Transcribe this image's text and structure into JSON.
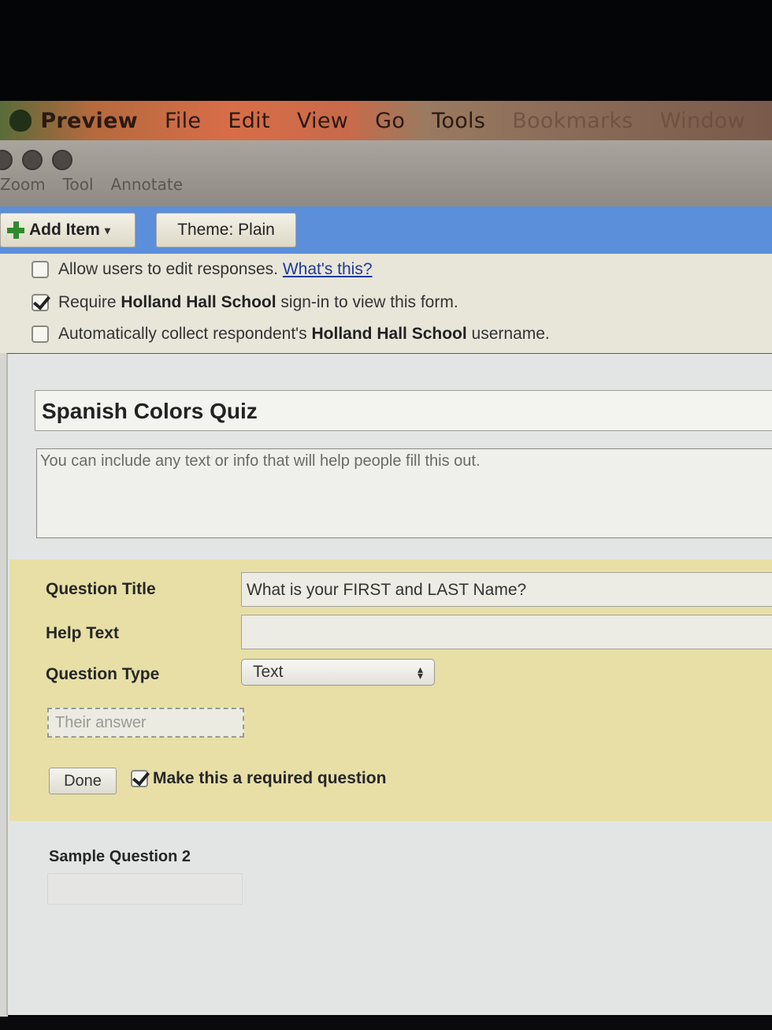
{
  "menubar": {
    "items": [
      "Preview",
      "File",
      "Edit",
      "View",
      "Go",
      "Tools",
      "Bookmarks",
      "Window"
    ]
  },
  "window": {
    "tools": [
      "Zoom",
      "Tool",
      "Annotate"
    ]
  },
  "toolbar": {
    "add_item_label": "Add Item",
    "theme_label": "Theme:  Plain"
  },
  "settings": {
    "allow_edit_text": "Allow users to edit responses.",
    "whats_this_link": "What's this?",
    "require_signin_prefix": "Require ",
    "require_signin_org": "Holland Hall School",
    "require_signin_suffix": " sign-in to view this form.",
    "collect_username_prefix": "Automatically collect respondent's ",
    "collect_username_org": "Holland Hall School",
    "collect_username_suffix": " username.",
    "allow_edit_checked": false,
    "require_signin_checked": true,
    "collect_username_checked": false
  },
  "form": {
    "title": "Spanish Colors Quiz",
    "description_placeholder": "You can include any text or info that will help people fill this out."
  },
  "question_editor": {
    "title_label": "Question Title",
    "title_value": "What is your FIRST and LAST Name?",
    "help_label": "Help Text",
    "help_value": "",
    "type_label": "Question Type",
    "type_value": "Text",
    "answer_preview": "Their answer",
    "done_label": "Done",
    "required_label": "Make this a required question",
    "required_checked": true
  },
  "next_question": {
    "title": "Sample Question 2"
  }
}
